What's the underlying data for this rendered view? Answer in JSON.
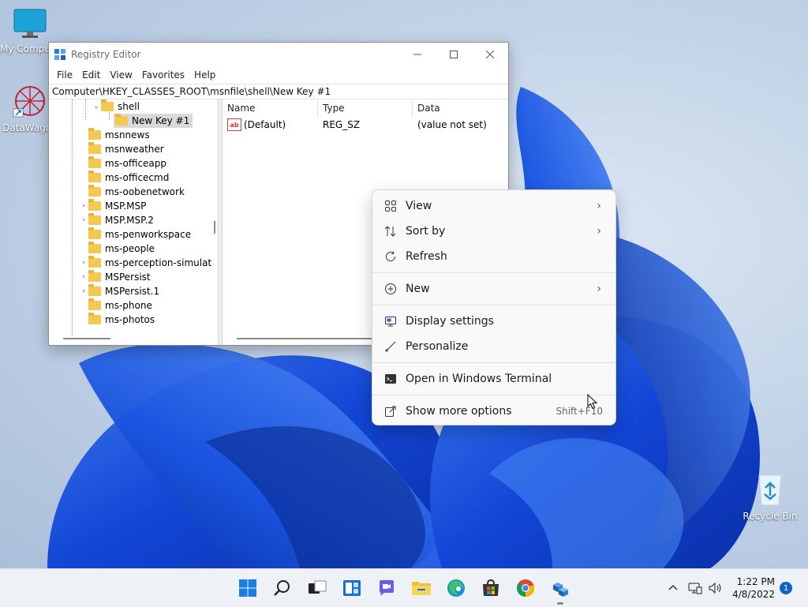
{
  "desktop": {
    "icons": [
      {
        "label": "My Computer"
      },
      {
        "label": "DataWagon"
      },
      {
        "label": "Recycle Bin"
      }
    ]
  },
  "regedit": {
    "title": "Registry Editor",
    "menu": [
      "File",
      "Edit",
      "View",
      "Favorites",
      "Help"
    ],
    "address": "Computer\\HKEY_CLASSES_ROOT\\msnfile\\shell\\New Key #1",
    "tree": [
      {
        "label": "shell",
        "expanded": true
      },
      {
        "label": "New Key #1",
        "selected": true
      },
      {
        "label": "msnnews"
      },
      {
        "label": "msnweather"
      },
      {
        "label": "ms-officeapp"
      },
      {
        "label": "ms-officecmd"
      },
      {
        "label": "ms-oobenetwork"
      },
      {
        "label": "MSP.MSP",
        "expandable": true
      },
      {
        "label": "MSP.MSP.2",
        "expandable": true
      },
      {
        "label": "ms-penworkspace"
      },
      {
        "label": "ms-people"
      },
      {
        "label": "ms-perception-simulat",
        "expandable": true
      },
      {
        "label": "MSPersist",
        "expandable": true
      },
      {
        "label": "MSPersist.1",
        "expandable": true
      },
      {
        "label": "ms-phone"
      },
      {
        "label": "ms-photos"
      }
    ],
    "columns": {
      "name": "Name",
      "type": "Type",
      "data": "Data"
    },
    "values": [
      {
        "name": "(Default)",
        "type": "REG_SZ",
        "data": "(value not set)"
      }
    ]
  },
  "context_menu": {
    "items": [
      {
        "label": "View",
        "icon": "grid-icon",
        "submenu": true
      },
      {
        "label": "Sort by",
        "icon": "sort-icon",
        "submenu": true
      },
      {
        "label": "Refresh",
        "icon": "refresh-icon"
      },
      {
        "label": "New",
        "icon": "plus-circle-icon",
        "submenu": true
      },
      {
        "label": "Display settings",
        "icon": "display-icon"
      },
      {
        "label": "Personalize",
        "icon": "brush-icon"
      },
      {
        "label": "Open in Windows Terminal",
        "icon": "terminal-icon"
      },
      {
        "label": "Show more options",
        "icon": "more-options-icon",
        "shortcut": "Shift+F10"
      }
    ]
  },
  "taskbar": {
    "time": "1:22 PM",
    "date": "4/8/2022",
    "notification_count": "1",
    "accent": "#0a63c9"
  }
}
